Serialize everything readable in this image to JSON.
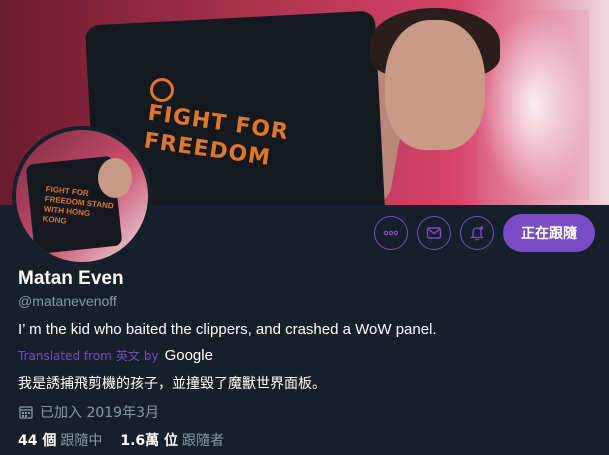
{
  "profile": {
    "name": "Matan Even",
    "handle": "@matanevenoff",
    "bio": "I’ m the kid who baited the clippers, and crashed a WoW panel.",
    "translated_prefix": "Translated from",
    "translated_lang": "英文",
    "translated_by": "by",
    "translated_engine": "Google",
    "bio_translated": "我是誘捕飛剪機的孩子，並撞毀了魔獸世界面板。",
    "joined": "已加入 2019年3月"
  },
  "banner": {
    "shirt_text": "FIGHT FOR FREEDOM"
  },
  "avatar": {
    "shirt_text": "FIGHT FOR FREEDOM STAND WITH HONG KONG"
  },
  "actions": {
    "follow_label": "正在跟隨",
    "more_icon": "more-icon",
    "message_icon": "mail-icon",
    "notify_icon": "bell-plus-icon"
  },
  "stats": {
    "following_count": "44 個",
    "following_label": "跟隨中",
    "followers_count": "1.6萬 位",
    "followers_label": "跟隨者"
  },
  "colors": {
    "accent": "#794bc4",
    "background": "#15202b",
    "secondary_text": "#8899a6"
  }
}
